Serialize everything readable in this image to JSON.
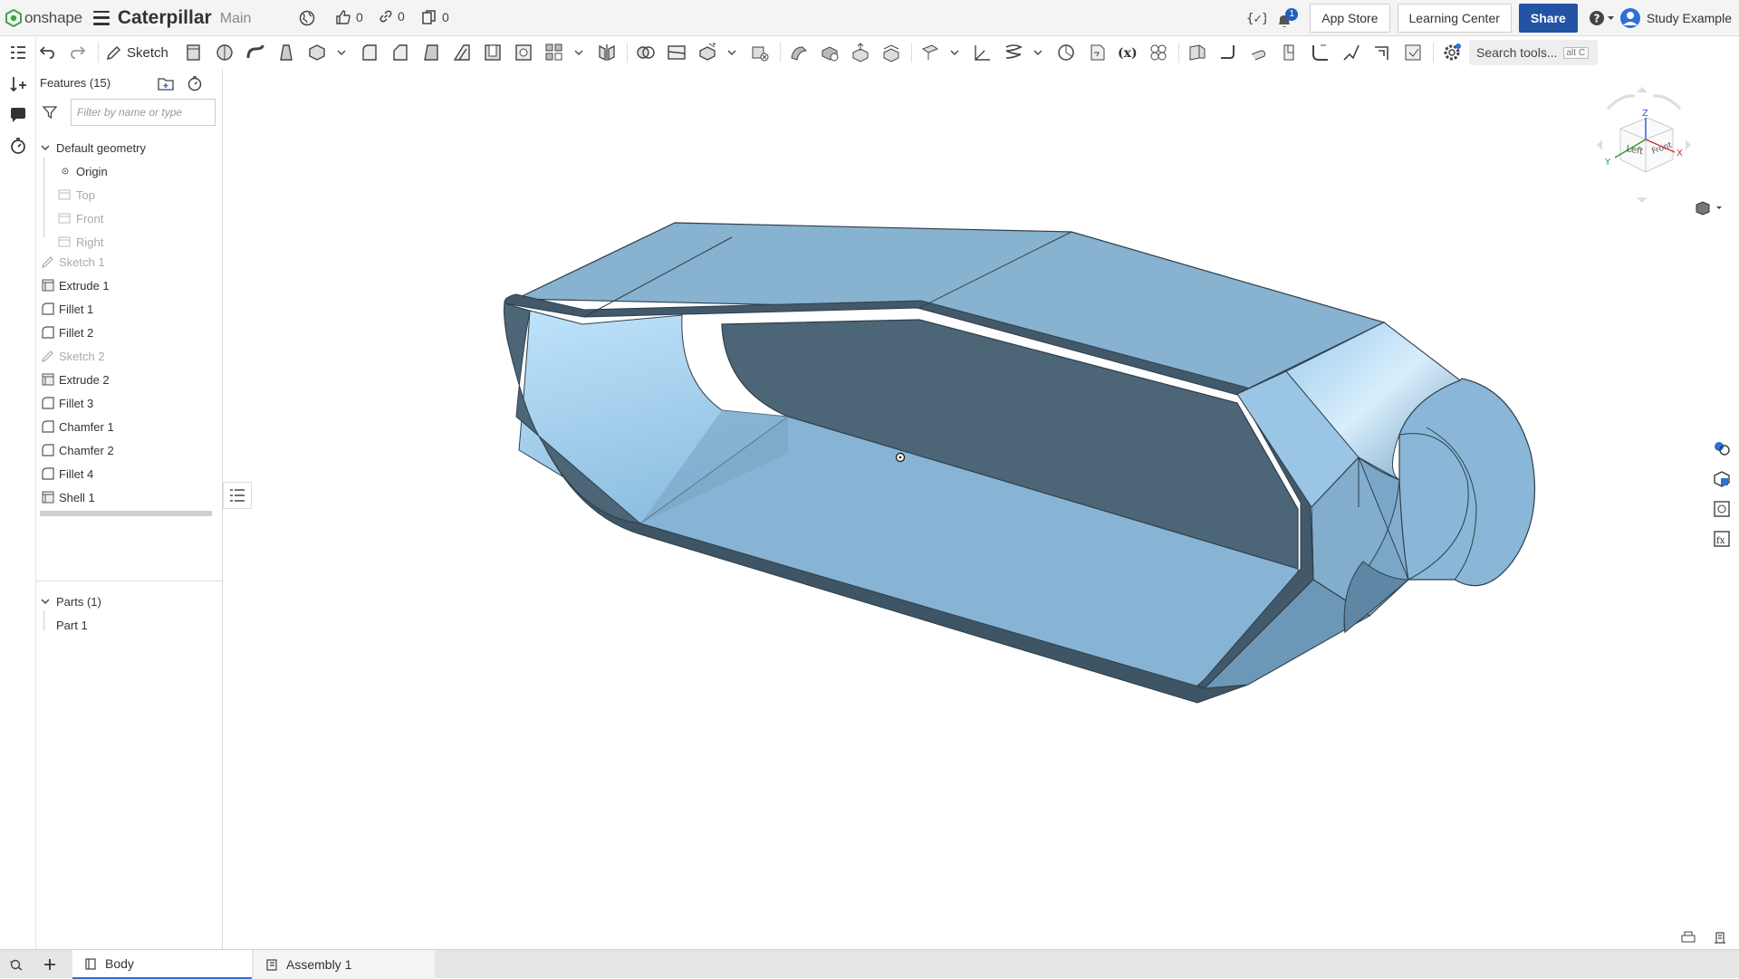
{
  "header": {
    "logo_text": "onshape",
    "document_title": "Caterpillar",
    "branch": "Main",
    "likes": "0",
    "links": "0",
    "copies": "0",
    "notifications_count": "1",
    "app_store_label": "App Store",
    "learning_center_label": "Learning Center",
    "share_label": "Share",
    "user_name": "Study Example"
  },
  "toolbar": {
    "sketch_label": "Sketch",
    "search_label": "Search tools...",
    "search_shortcut": "alt C"
  },
  "feature_panel": {
    "title": "Features (15)",
    "filter_placeholder": "Filter by name or type",
    "default_geometry_label": "Default geometry",
    "default_geometry": [
      "Origin",
      "Top",
      "Front",
      "Right"
    ],
    "features": [
      {
        "label": "Sketch 1",
        "type": "sketch"
      },
      {
        "label": "Extrude 1",
        "type": "extrude"
      },
      {
        "label": "Fillet 1",
        "type": "fillet"
      },
      {
        "label": "Fillet 2",
        "type": "fillet"
      },
      {
        "label": "Sketch 2",
        "type": "sketch"
      },
      {
        "label": "Extrude 2",
        "type": "extrude"
      },
      {
        "label": "Fillet 3",
        "type": "fillet"
      },
      {
        "label": "Chamfer 1",
        "type": "fillet"
      },
      {
        "label": "Chamfer 2",
        "type": "fillet"
      },
      {
        "label": "Fillet 4",
        "type": "fillet"
      },
      {
        "label": "Shell 1",
        "type": "extrude"
      }
    ],
    "parts_label": "Parts (1)",
    "parts": [
      "Part 1"
    ]
  },
  "view_cube": {
    "top_label": "Z",
    "left_face": "Left",
    "front_face": "Front",
    "x_axis": "X",
    "y_axis": "Y"
  },
  "tabs": [
    {
      "label": "Body",
      "active": true
    },
    {
      "label": "Assembly 1",
      "active": false
    }
  ],
  "colors": {
    "accent": "#2254a3",
    "part_light": "#a9d2ee",
    "part_mid": "#87b2d0",
    "part_dark": "#4c6577",
    "edge": "#2e3e4a"
  }
}
